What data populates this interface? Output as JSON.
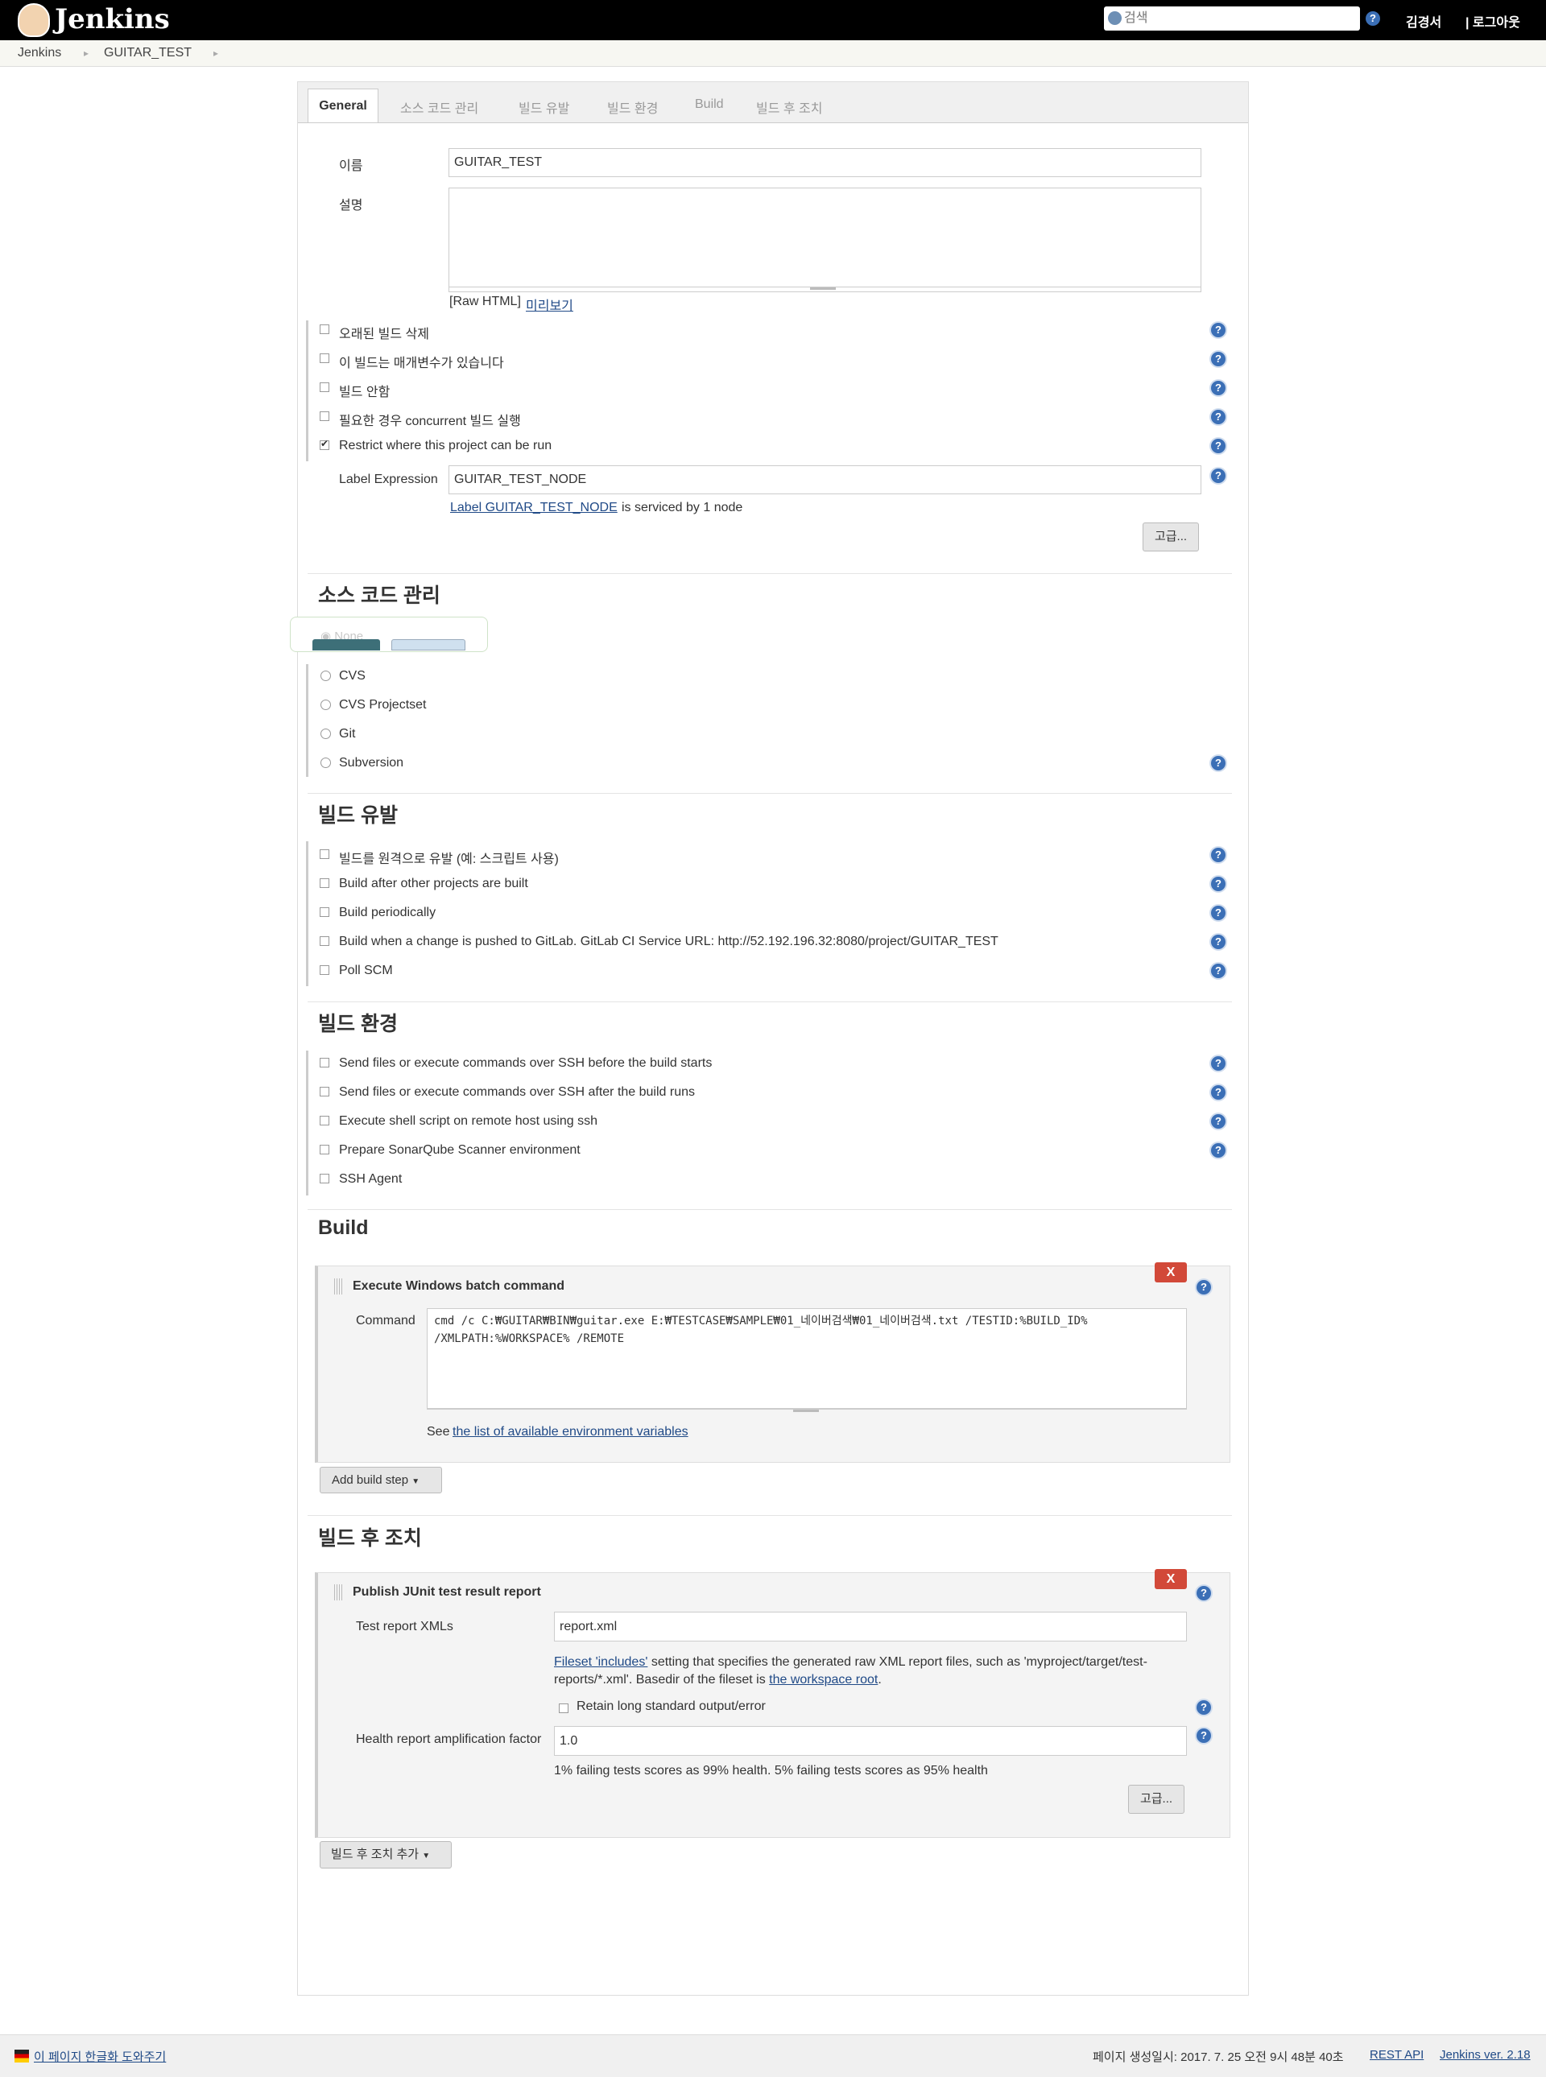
{
  "header": {
    "app_title": "Jenkins",
    "search_placeholder": "검색",
    "help_label": "?",
    "user": "김경서",
    "logout": "| 로그아웃"
  },
  "breadcrumb": [
    "Jenkins",
    "GUITAR_TEST"
  ],
  "tabs": [
    "General",
    "소스 코드 관리",
    "빌드 유발",
    "빌드 환경",
    "Build",
    "빌드 후 조치"
  ],
  "general": {
    "name_label": "이름",
    "name_value": "GUITAR_TEST",
    "desc_label": "설명",
    "desc_value": "",
    "raw_html": "[Raw HTML]",
    "preview": "미리보기",
    "options": [
      {
        "label": "오래된 빌드 삭제",
        "checked": false
      },
      {
        "label": "이 빌드는 매개변수가 있습니다",
        "checked": false
      },
      {
        "label": "빌드 안함",
        "checked": false
      },
      {
        "label": "필요한 경우 concurrent 빌드 실행",
        "checked": false
      },
      {
        "label": "Restrict where this project can be run",
        "checked": true
      }
    ],
    "label_expr_label": "Label Expression",
    "label_expr_value": "GUITAR_TEST_NODE",
    "label_link": "Label GUITAR_TEST_NODE",
    "label_suffix": " is serviced by 1 node",
    "advanced": "고급..."
  },
  "scm": {
    "title": "소스 코드 관리",
    "none_label": "None",
    "options": [
      "CVS",
      "CVS Projectset",
      "Git",
      "Subversion"
    ]
  },
  "triggers": {
    "title": "빌드 유발",
    "options": [
      "빌드를 원격으로 유발 (예: 스크립트 사용)",
      "Build after other projects are built",
      "Build periodically",
      "Build when a change is pushed to GitLab. GitLab CI Service URL: http://52.192.196.32:8080/project/GUITAR_TEST",
      "Poll SCM"
    ]
  },
  "env": {
    "title": "빌드 환경",
    "options": [
      "Send files or execute commands over SSH before the build starts",
      "Send files or execute commands over SSH after the build runs",
      "Execute shell script on remote host using ssh",
      "Prepare SonarQube Scanner environment",
      "SSH Agent"
    ]
  },
  "build": {
    "title": "Build",
    "step_title": "Execute Windows batch command",
    "delete": "X",
    "command_label": "Command",
    "command_line1": "cmd /c C:₩GUITAR₩BIN₩guitar.exe E:₩TESTCASE₩SAMPLE₩01_네이버검색₩01_네이버검색.txt /TESTID:%BUILD_ID%",
    "command_line2": "/XMLPATH:%WORKSPACE% /REMOTE",
    "see": "See ",
    "env_link": "the list of available environment variables",
    "add_step": "Add build step"
  },
  "post": {
    "title": "빌드 후 조치",
    "step_title": "Publish JUnit test result report",
    "delete": "X",
    "xml_label": "Test report XMLs",
    "xml_value": "report.xml",
    "fileset_link": "Fileset 'includes'",
    "fileset_text1": " setting that specifies the generated raw XML report files, such as 'myproject/target/test-",
    "fileset_text2": "reports/*.xml'. Basedir of the fileset is ",
    "workspace_link": "the workspace root",
    "period": ".",
    "retain_label": "Retain long standard output/error",
    "health_label": "Health report amplification factor",
    "health_value": "1.0",
    "health_hint": "1% failing tests scores as 99% health. 5% failing tests scores as 95% health",
    "advanced": "고급...",
    "add_action": "빌드 후 조치 추가"
  },
  "footer": {
    "translate_link": "이 페이지 한글화 도와주기",
    "generated": "페이지 생성일시: 2017. 7. 25 오전 9시 48분 40초",
    "rest_api": "REST API",
    "version": "Jenkins ver. 2.18"
  }
}
